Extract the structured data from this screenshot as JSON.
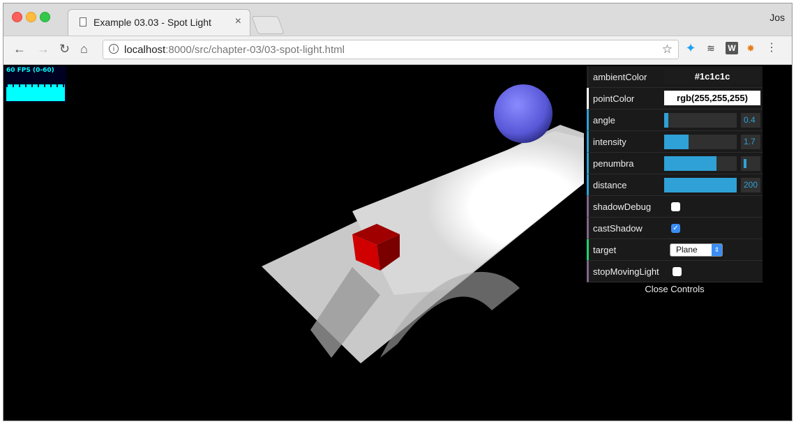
{
  "browser": {
    "tab_title": "Example 03.03 - Spot Light",
    "tab_close": "×",
    "profile_name": "Jos",
    "url_host": "localhost",
    "url_path": ":8000/src/chapter-03/03-spot-light.html",
    "icons": [
      "back-icon",
      "forward-icon",
      "reload-icon",
      "home-icon",
      "info-icon",
      "star-icon",
      "twitter-icon",
      "buffer-icon",
      "w-extension-icon",
      "metamask-icon",
      "menu-icon"
    ],
    "ext_w_label": "W"
  },
  "stats": {
    "label": "60 FPS (0-60)"
  },
  "gui": {
    "ambientColor": {
      "label": "ambientColor",
      "value": "#1c1c1c"
    },
    "pointColor": {
      "label": "pointColor",
      "value": "rgb(255,255,255)"
    },
    "angle": {
      "label": "angle",
      "value": "0.4",
      "fill": 0.06
    },
    "intensity": {
      "label": "intensity",
      "value": "1.7",
      "fill": 0.34
    },
    "penumbra": {
      "label": "penumbra",
      "fill": 0.72
    },
    "distance": {
      "label": "distance",
      "value": "200",
      "fill": 1.0
    },
    "shadowDebug": {
      "label": "shadowDebug",
      "checked": false
    },
    "castShadow": {
      "label": "castShadow",
      "checked": true
    },
    "target": {
      "label": "target",
      "selected": "Plane"
    },
    "stopMovingLight": {
      "label": "stopMovingLight",
      "checked": false
    },
    "close_label": "Close Controls"
  },
  "scene": {
    "sphere_color": "#5c5ce0",
    "cube_color": "#c80000",
    "plane_color": "#cccccc"
  }
}
